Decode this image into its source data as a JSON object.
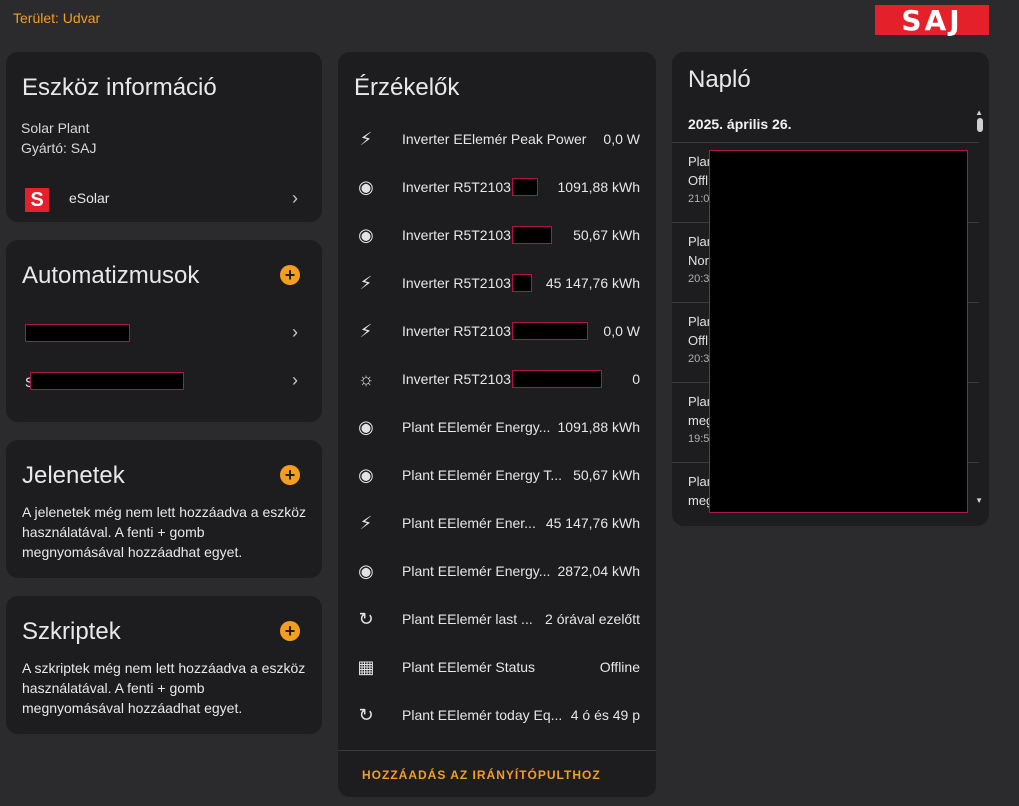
{
  "header": {
    "area_label": "Terület: Udvar",
    "logo_text": "SAJ"
  },
  "device_info": {
    "title": "Eszköz információ",
    "model": "Solar Plant",
    "manufacturer": "Gyártó: SAJ",
    "integration_label": "eSolar",
    "integration_icon_text": "S"
  },
  "automations": {
    "title": "Automatizmusok",
    "item2_prefix": "S"
  },
  "scenes": {
    "title": "Jelenetek",
    "text": "A jelenetek még nem lett hozzáadva a eszköz használatával. A fenti + gomb megnyomásával hozzáadhat egyet."
  },
  "scripts": {
    "title": "Szkriptek",
    "text": "A szkriptek még nem lett hozzáadva a eszköz használatával. A fenti + gomb megnyomásával hozzáadhat egyet."
  },
  "sensors": {
    "title": "Érzékelők",
    "items": [
      {
        "icon": "solar-power-icon",
        "name": "Inverter EElemér Peak Power",
        "value": "0,0 W"
      },
      {
        "icon": "energy-icon",
        "name": "Inverter R5T2103",
        "value": "1091,88 kWh"
      },
      {
        "icon": "energy-icon",
        "name": "Inverter R5T2103",
        "value": "50,67 kWh"
      },
      {
        "icon": "solar-power-icon",
        "name": "Inverter R5T2103",
        "value": "45 147,76 kWh"
      },
      {
        "icon": "solar-power-icon",
        "name": "Inverter R5T2103",
        "value": "0,0 W"
      },
      {
        "icon": "alarm-light-icon",
        "name": "Inverter R5T2103",
        "value": "0"
      },
      {
        "icon": "energy-icon",
        "name": "Plant EElemér Energy...",
        "value": "1091,88 kWh"
      },
      {
        "icon": "energy-icon",
        "name": "Plant EElemér Energy T...",
        "value": "50,67 kWh"
      },
      {
        "icon": "solar-power-icon",
        "name": "Plant EElemér Ener...",
        "value": "45 147,76 kWh"
      },
      {
        "icon": "energy-icon",
        "name": "Plant EElemér Energy...",
        "value": "2872,04 kWh"
      },
      {
        "icon": "history-icon",
        "name": "Plant EElemér last ...",
        "value": "2 órával ezelőtt"
      },
      {
        "icon": "solar-panel-icon",
        "name": "Plant EElemér Status",
        "value": "Offline"
      },
      {
        "icon": "history-icon",
        "name": "Plant EElemér today Eq...",
        "value": "4 ó és 49 p"
      }
    ],
    "footer": "HOZZÁADÁS AZ IRÁNYÍTÓPULTHOZ"
  },
  "log": {
    "title": "Napló",
    "date": "2025. április 26.",
    "entries": [
      {
        "line1": "Plan",
        "line2": "Offl",
        "time": "21:0"
      },
      {
        "line1": "Plan",
        "line2": "Nor",
        "time": "20:3"
      },
      {
        "line1": "Plan",
        "line2": "Offl",
        "time": "20:3"
      },
      {
        "line1": "Plan",
        "line2": "meg",
        "time": "19:5"
      },
      {
        "line1": "Plan",
        "line2": "meg",
        "time": ""
      }
    ]
  }
}
